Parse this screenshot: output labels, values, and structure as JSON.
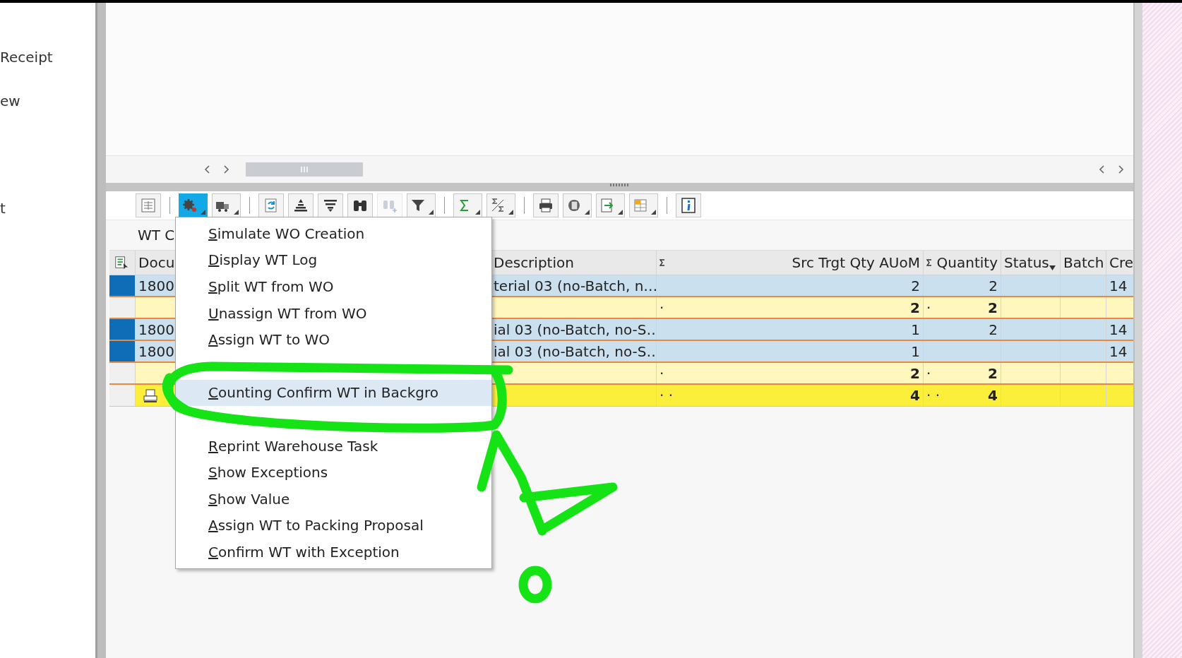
{
  "left_panel": {
    "items": [
      {
        "label": "Receipt"
      },
      {
        "label": "ew"
      },
      {
        "label": "t"
      }
    ]
  },
  "toolbar": {
    "items": [
      {
        "kind": "layout",
        "dropdown": false,
        "selected": false,
        "disabled": false
      },
      {
        "kind": "separator"
      },
      {
        "kind": "gear",
        "dropdown": true,
        "selected": true,
        "disabled": false
      },
      {
        "kind": "truck",
        "dropdown": true,
        "selected": false,
        "disabled": false
      },
      {
        "kind": "separator"
      },
      {
        "kind": "refresh",
        "dropdown": false,
        "selected": false,
        "disabled": false
      },
      {
        "kind": "ascending",
        "dropdown": false,
        "selected": false,
        "disabled": false
      },
      {
        "kind": "descending",
        "dropdown": false,
        "selected": false,
        "disabled": false
      },
      {
        "kind": "find",
        "dropdown": false,
        "selected": false,
        "disabled": false
      },
      {
        "kind": "findnext",
        "dropdown": false,
        "selected": false,
        "disabled": true
      },
      {
        "kind": "filter",
        "dropdown": true,
        "selected": false,
        "disabled": false
      },
      {
        "kind": "separator"
      },
      {
        "kind": "sum",
        "dropdown": true,
        "selected": false,
        "disabled": false
      },
      {
        "kind": "subtotal",
        "dropdown": true,
        "selected": false,
        "disabled": false
      },
      {
        "kind": "separator"
      },
      {
        "kind": "print",
        "dropdown": false,
        "selected": false,
        "disabled": false
      },
      {
        "kind": "views",
        "dropdown": true,
        "selected": false,
        "disabled": false
      },
      {
        "kind": "export",
        "dropdown": true,
        "selected": false,
        "disabled": false
      },
      {
        "kind": "grid",
        "dropdown": true,
        "selected": false,
        "disabled": false
      },
      {
        "kind": "separator"
      },
      {
        "kind": "info",
        "dropdown": false,
        "selected": false,
        "disabled": false
      }
    ]
  },
  "title": "WT C",
  "table": {
    "columns": [
      {
        "kind": "selector"
      },
      {
        "kind": "text",
        "label": "Docu"
      },
      {
        "kind": "covered"
      },
      {
        "kind": "text",
        "label": "Description"
      },
      {
        "kind": "number",
        "label": "Src Trgt Qty AUoM",
        "summed": true
      },
      {
        "kind": "number",
        "label": "Quantity",
        "summed": true
      },
      {
        "kind": "sorted",
        "label": "Status"
      },
      {
        "kind": "text",
        "label": "Batch"
      },
      {
        "kind": "text",
        "label": "Cre"
      }
    ],
    "rows": [
      {
        "kind": "item",
        "selected": true,
        "cells": [
          null,
          "1800",
          null,
          "terial 03 (no-Batch, n…",
          "2",
          "2",
          null,
          null,
          "14"
        ]
      },
      {
        "kind": "subtotal",
        "selected": false,
        "sum_marks": "·",
        "cells": [
          null,
          null,
          null,
          null,
          "2",
          "2",
          null,
          null,
          null
        ]
      },
      {
        "kind": "item",
        "selected": true,
        "cells": [
          null,
          "1800",
          null,
          "ial 03 (no-Batch, no-S…",
          "1",
          "2",
          null,
          null,
          "14"
        ]
      },
      {
        "kind": "item",
        "selected": true,
        "cells": [
          null,
          "1800",
          null,
          "ial 03 (no-Batch, no-S…",
          "1",
          null,
          null,
          null,
          "14"
        ]
      },
      {
        "kind": "subtotal",
        "selected": false,
        "sum_marks": "·",
        "cells": [
          null,
          null,
          null,
          null,
          "2",
          "2",
          null,
          null,
          null
        ]
      },
      {
        "kind": "total",
        "selected": false,
        "sum_marks": "· ·",
        "cells": [
          null,
          null,
          null,
          null,
          "4",
          "4",
          null,
          null,
          null
        ]
      }
    ]
  },
  "context_menu": {
    "items": [
      {
        "kind": "entry",
        "label": "Simulate WO Creation",
        "selected": false
      },
      {
        "kind": "entry",
        "label": "Display WT Log",
        "selected": false
      },
      {
        "kind": "entry",
        "label": "Split WT from WO",
        "selected": false
      },
      {
        "kind": "entry",
        "label": "Unassign WT from WO",
        "selected": false
      },
      {
        "kind": "entry",
        "label": "Assign WT to WO",
        "selected": false
      },
      {
        "kind": "covered"
      },
      {
        "kind": "entry",
        "label": "Counting Confirm WT in Backgro",
        "selected": true
      },
      {
        "kind": "covered"
      },
      {
        "kind": "entry",
        "label": "Reprint Warehouse Task",
        "selected": false
      },
      {
        "kind": "entry",
        "label": "Show Exceptions",
        "selected": false
      },
      {
        "kind": "entry",
        "label": "Show Value",
        "selected": false
      },
      {
        "kind": "entry",
        "label": "Assign WT to Packing Proposal",
        "selected": false
      },
      {
        "kind": "entry",
        "label": "Confirm WT with Exception",
        "selected": false
      }
    ]
  }
}
